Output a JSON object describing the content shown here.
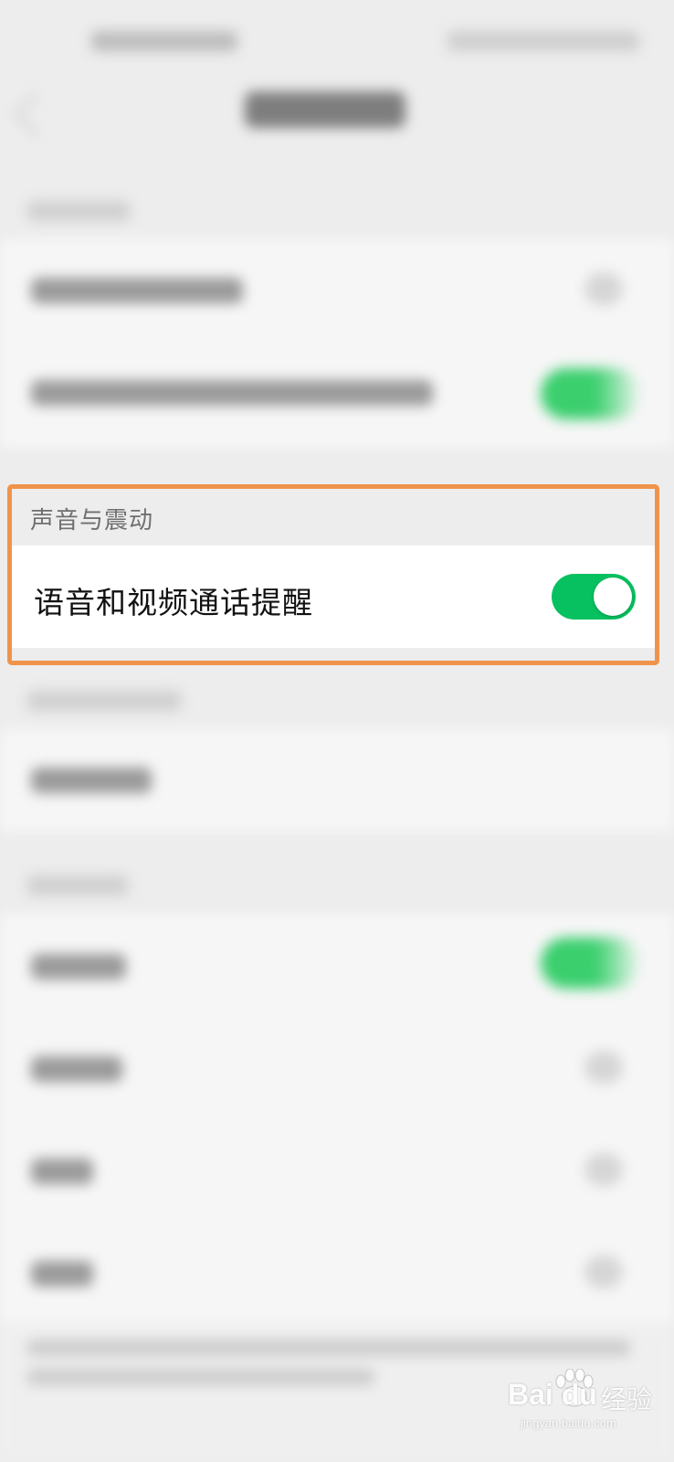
{
  "section": {
    "header": "声音与震动",
    "row_label": "语音和视频通话提醒",
    "toggle_on": true
  },
  "colors": {
    "highlight_border": "#f0934a",
    "toggle_on": "#07c160",
    "section_bg": "#ededed",
    "row_bg": "#ffffff"
  },
  "watermark": {
    "brand": "Bai  du",
    "product": "经验",
    "url": "jingyan.baidu.com"
  }
}
